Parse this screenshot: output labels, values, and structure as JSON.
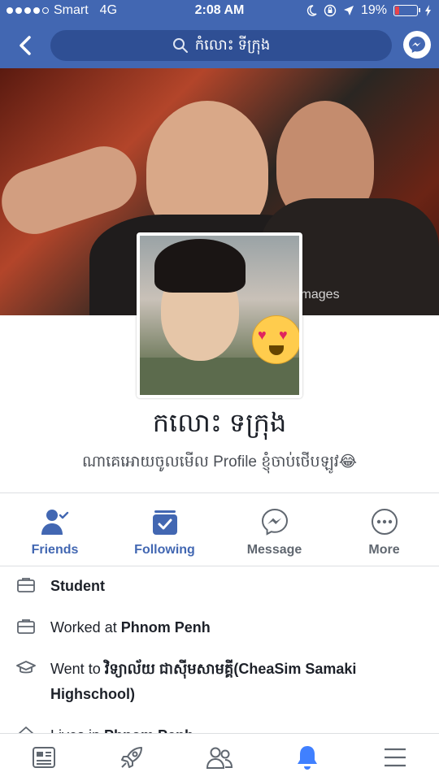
{
  "status_bar": {
    "carrier": "Smart",
    "network": "4G",
    "time": "2:08 AM",
    "battery_percent": "19%",
    "battery_level": 0.19
  },
  "nav": {
    "search_text": "កំលោះ ទីក្រុង",
    "icons": [
      "back-icon",
      "search-icon",
      "messenger-icon"
    ]
  },
  "cover": {
    "watermark": "images"
  },
  "profile": {
    "name": "កលោះ ទក្រុង",
    "bio": "ណាគេអោយចូលមើល Profile ខ្ញុំចាប់ថើបឡូវ😂"
  },
  "actions": [
    {
      "label": "Friends",
      "icon": "friends-icon",
      "active": true
    },
    {
      "label": "Following",
      "icon": "following-icon",
      "active": true
    },
    {
      "label": "Message",
      "icon": "messenger-icon",
      "active": false
    },
    {
      "label": "More",
      "icon": "more-icon",
      "active": false
    }
  ],
  "intro": {
    "student": "Student",
    "worked_prefix": "Worked at ",
    "worked_place": "Phnom Penh",
    "went_prefix": "Went to ",
    "went_place": "វិទ្យាល័យ ជាស៊ីមសាមគ្គី(CheaSim Samaki Highschool)",
    "lives_prefix": "Lives in ",
    "lives_place": "Phnom Penh"
  },
  "tab_bar": [
    "news-feed-icon",
    "explore-icon",
    "friends-tab-icon",
    "notifications-icon",
    "menu-icon"
  ],
  "colors": {
    "brand": "#4267b2",
    "accent": "#4080ff",
    "text": "#1d2129",
    "secondary": "#606770"
  }
}
